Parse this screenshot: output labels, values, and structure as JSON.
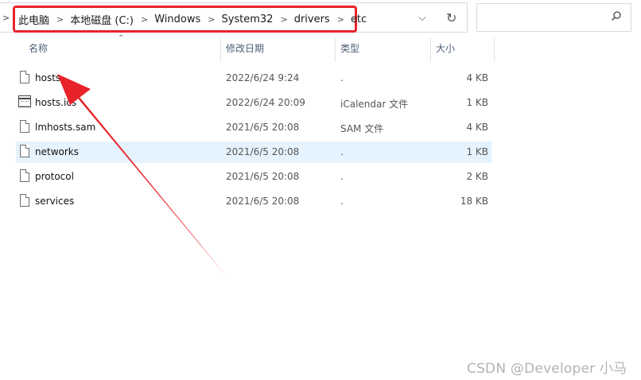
{
  "address_bar": {
    "crumbs": [
      "此电脑",
      "本地磁盘 (C:)",
      "Windows",
      "System32",
      "drivers",
      "etc"
    ],
    "separator": ">",
    "lead_chevron": ">",
    "dropdown_glyph": "⌵",
    "refresh_glyph": "↻"
  },
  "search": {
    "value": "",
    "placeholder": "",
    "icon": "search-icon"
  },
  "columns": {
    "name": "名称",
    "date": "修改日期",
    "type": "类型",
    "size": "大小"
  },
  "files": [
    {
      "name": "hosts",
      "date": "2022/6/24 9:24",
      "type": ".",
      "size": "4 KB",
      "icon": "file-icon"
    },
    {
      "name": "hosts.ics",
      "date": "2022/6/24 20:09",
      "type": "iCalendar 文件",
      "size": "1 KB",
      "icon": "calendar-file-icon"
    },
    {
      "name": "lmhosts.sam",
      "date": "2021/6/5 20:08",
      "type": "SAM 文件",
      "size": "4 KB",
      "icon": "file-icon"
    },
    {
      "name": "networks",
      "date": "2021/6/5 20:08",
      "type": ".",
      "size": "1 KB",
      "icon": "file-icon"
    },
    {
      "name": "protocol",
      "date": "2021/6/5 20:08",
      "type": ".",
      "size": "2 KB",
      "icon": "file-icon"
    },
    {
      "name": "services",
      "date": "2021/6/5 20:08",
      "type": ".",
      "size": "18 KB",
      "icon": "file-icon"
    }
  ],
  "selected_row": "networks",
  "watermark": "CSDN @Developer 小马",
  "colors": {
    "annotation_red": "#e8232a",
    "selection": "#e5f3ff",
    "header_text": "#4d5e78"
  }
}
